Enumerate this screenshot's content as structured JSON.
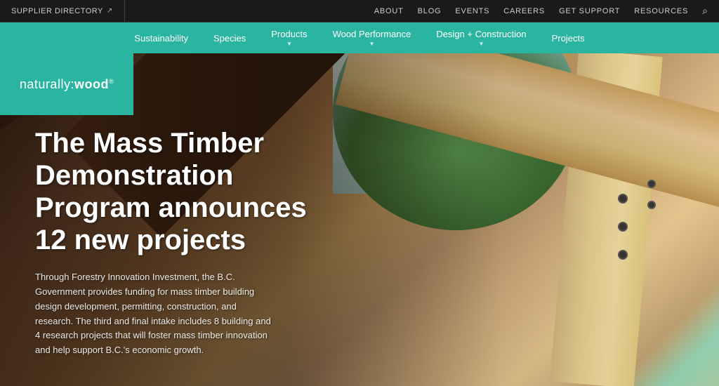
{
  "top_bar": {
    "supplier_link": "SUPPLIER DIRECTORY",
    "nav_items": [
      "ABOUT",
      "BLOG",
      "EVENTS",
      "CAREERS",
      "GET SUPPORT",
      "RESOURCES"
    ]
  },
  "secondary_nav": {
    "items": [
      {
        "label": "Sustainability",
        "has_dropdown": false
      },
      {
        "label": "Species",
        "has_dropdown": false
      },
      {
        "label": "Products",
        "has_dropdown": false
      },
      {
        "label": "Wood Performance",
        "has_dropdown": true
      },
      {
        "label": "Design + Construction",
        "has_dropdown": true
      },
      {
        "label": "Projects",
        "has_dropdown": false
      }
    ]
  },
  "logo": {
    "text": "naturally:wood",
    "registered": "®"
  },
  "hero": {
    "headline": "The Mass Timber Demonstration Program announces 12 new projects",
    "body": "Through Forestry Innovation Investment, the B.C. Government provides funding for mass timber building design development, permitting, construction, and research. The third and final intake includes 8 building and 4 research projects that will foster mass timber innovation and help support B.C.'s economic growth."
  }
}
